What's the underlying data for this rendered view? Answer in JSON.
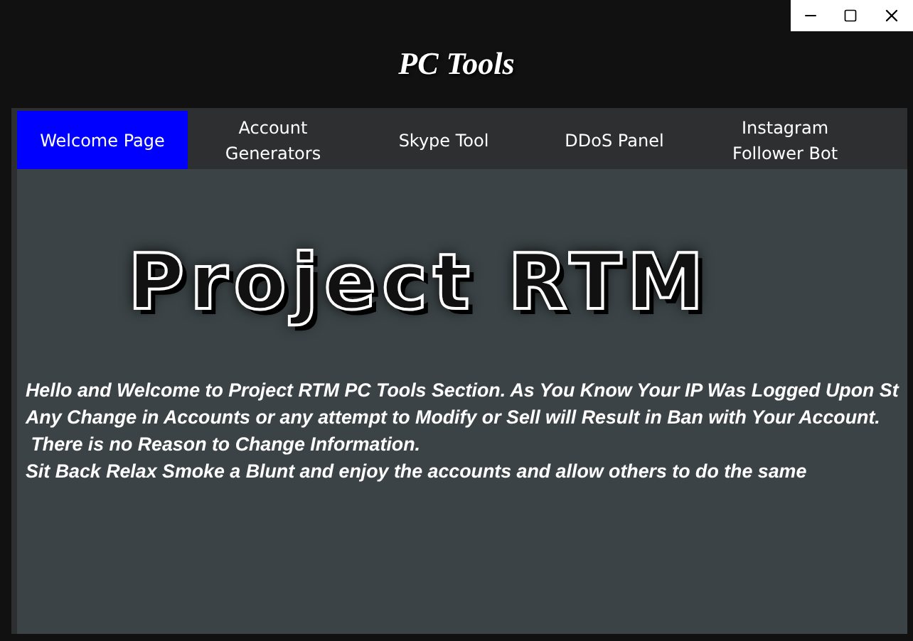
{
  "window": {
    "title": "PC Tools"
  },
  "tabs": [
    {
      "label": "Welcome Page",
      "selected": true
    },
    {
      "label": "Account Generators",
      "selected": false
    },
    {
      "label": "Skype Tool",
      "selected": false
    },
    {
      "label": "DDoS Panel",
      "selected": false
    },
    {
      "label": "Instagram Follower Bot",
      "selected": false
    }
  ],
  "logo": "Project RTM",
  "message": [
    "Hello and Welcome to Project RTM PC Tools Section. As You Know Your IP Was Logged Upon St",
    "Any Change in Accounts or any attempt to Modify or Sell will Result in Ban with Your Account.",
    " There is no Reason to Change Information.",
    "Sit Back Relax Smoke a Blunt and enjoy the accounts and allow others to do the same"
  ]
}
